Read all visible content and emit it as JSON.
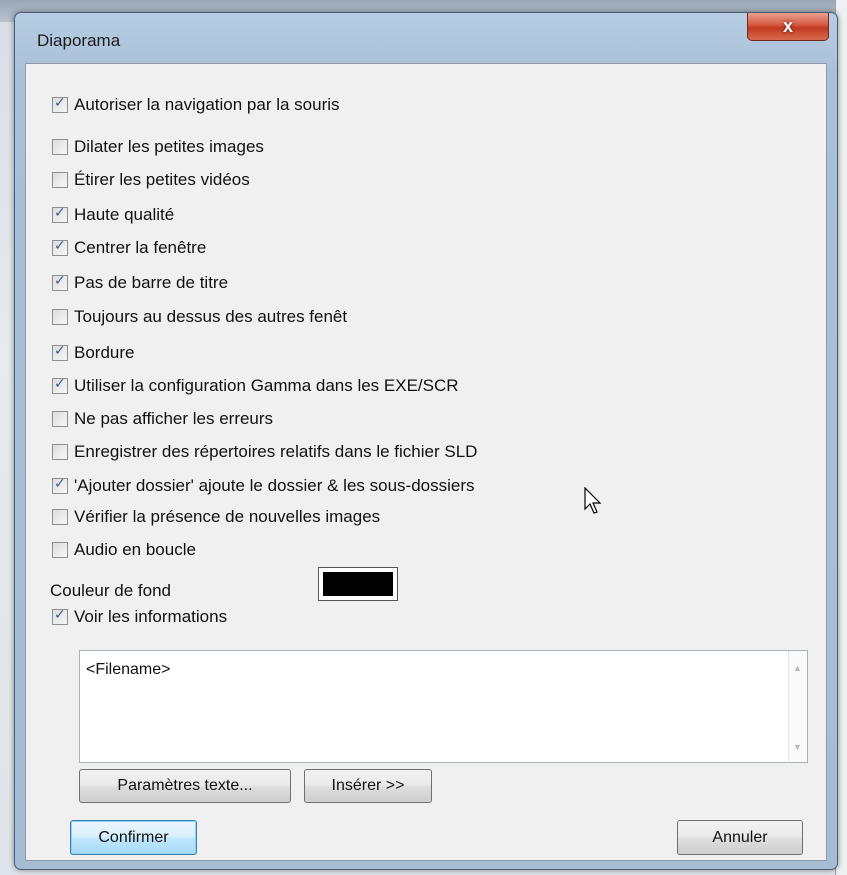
{
  "window": {
    "title": "Diaporama",
    "close_symbol": "x"
  },
  "options": [
    {
      "label": "Autoriser la navigation par la souris",
      "checked": true
    },
    {
      "label": "Dilater les petites images",
      "checked": false
    },
    {
      "label": "Étirer les petites vidéos",
      "checked": false
    },
    {
      "label": "Haute qualité",
      "checked": true
    },
    {
      "label": "Centrer la fenêtre",
      "checked": true
    },
    {
      "label": "Pas de barre de titre",
      "checked": true
    },
    {
      "label": "Toujours au dessus des autres fenêt",
      "checked": false
    },
    {
      "label": "Bordure",
      "checked": true
    },
    {
      "label": "Utiliser la configuration Gamma dans les EXE/SCR",
      "checked": true
    },
    {
      "label": "Ne pas afficher les erreurs",
      "checked": false
    },
    {
      "label": "Enregistrer des répertoires relatifs dans le fichier SLD",
      "checked": false
    },
    {
      "label": "'Ajouter dossier' ajoute le dossier & les sous-dossiers",
      "checked": true
    },
    {
      "label": "Vérifier la présence de nouvelles images",
      "checked": false
    },
    {
      "label": "Audio en boucle",
      "checked": false
    }
  ],
  "background_color": {
    "label": "Couleur de fond",
    "value": "#000000"
  },
  "show_info": {
    "label": "Voir les informations",
    "checked": true
  },
  "info_text": {
    "value": "<Filename>"
  },
  "buttons": {
    "text_settings": "Paramètres texte...",
    "insert": "Insérer >>",
    "confirm": "Confirmer",
    "cancel": "Annuler"
  },
  "icons": {
    "check": "check-icon",
    "close": "close-icon",
    "cursor": "mouse-pointer-icon"
  }
}
